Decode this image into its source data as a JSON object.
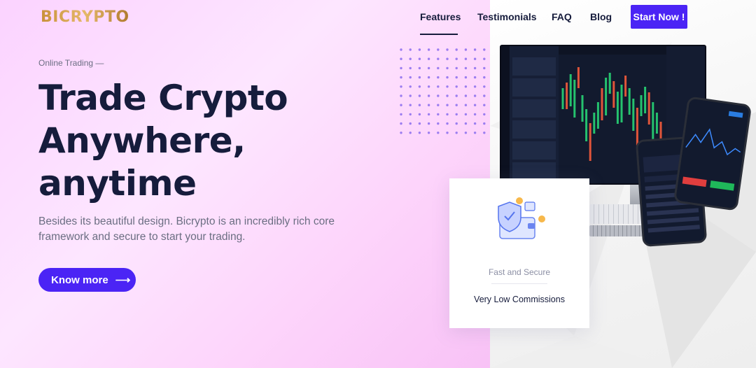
{
  "brand": {
    "logo_text": "BICRYPTO"
  },
  "nav": {
    "items": [
      {
        "label": "Features",
        "active": true
      },
      {
        "label": "Testimonials",
        "active": false
      },
      {
        "label": "FAQ",
        "active": false
      },
      {
        "label": "Blog",
        "active": false
      }
    ],
    "cta_label": "Start Now !"
  },
  "hero": {
    "eyebrow": "Online Trading —",
    "headline_lines": [
      "Trade Crypto",
      "Anywhere,",
      "anytime"
    ],
    "description": "Besides its beautiful design. Bicrypto is an incredibly rich core framework and secure to start your trading.",
    "button_label": "Know more",
    "button_icon": "arrow-right-icon"
  },
  "feature_card": {
    "icon": "wallet-shield-icon",
    "title": "Fast and Secure",
    "subtitle": "Very Low Commissions"
  },
  "colors": {
    "accent": "#4b24f5",
    "heading": "#161c3c",
    "muted": "#6b6e82",
    "logo_gold": "#c8913a"
  }
}
